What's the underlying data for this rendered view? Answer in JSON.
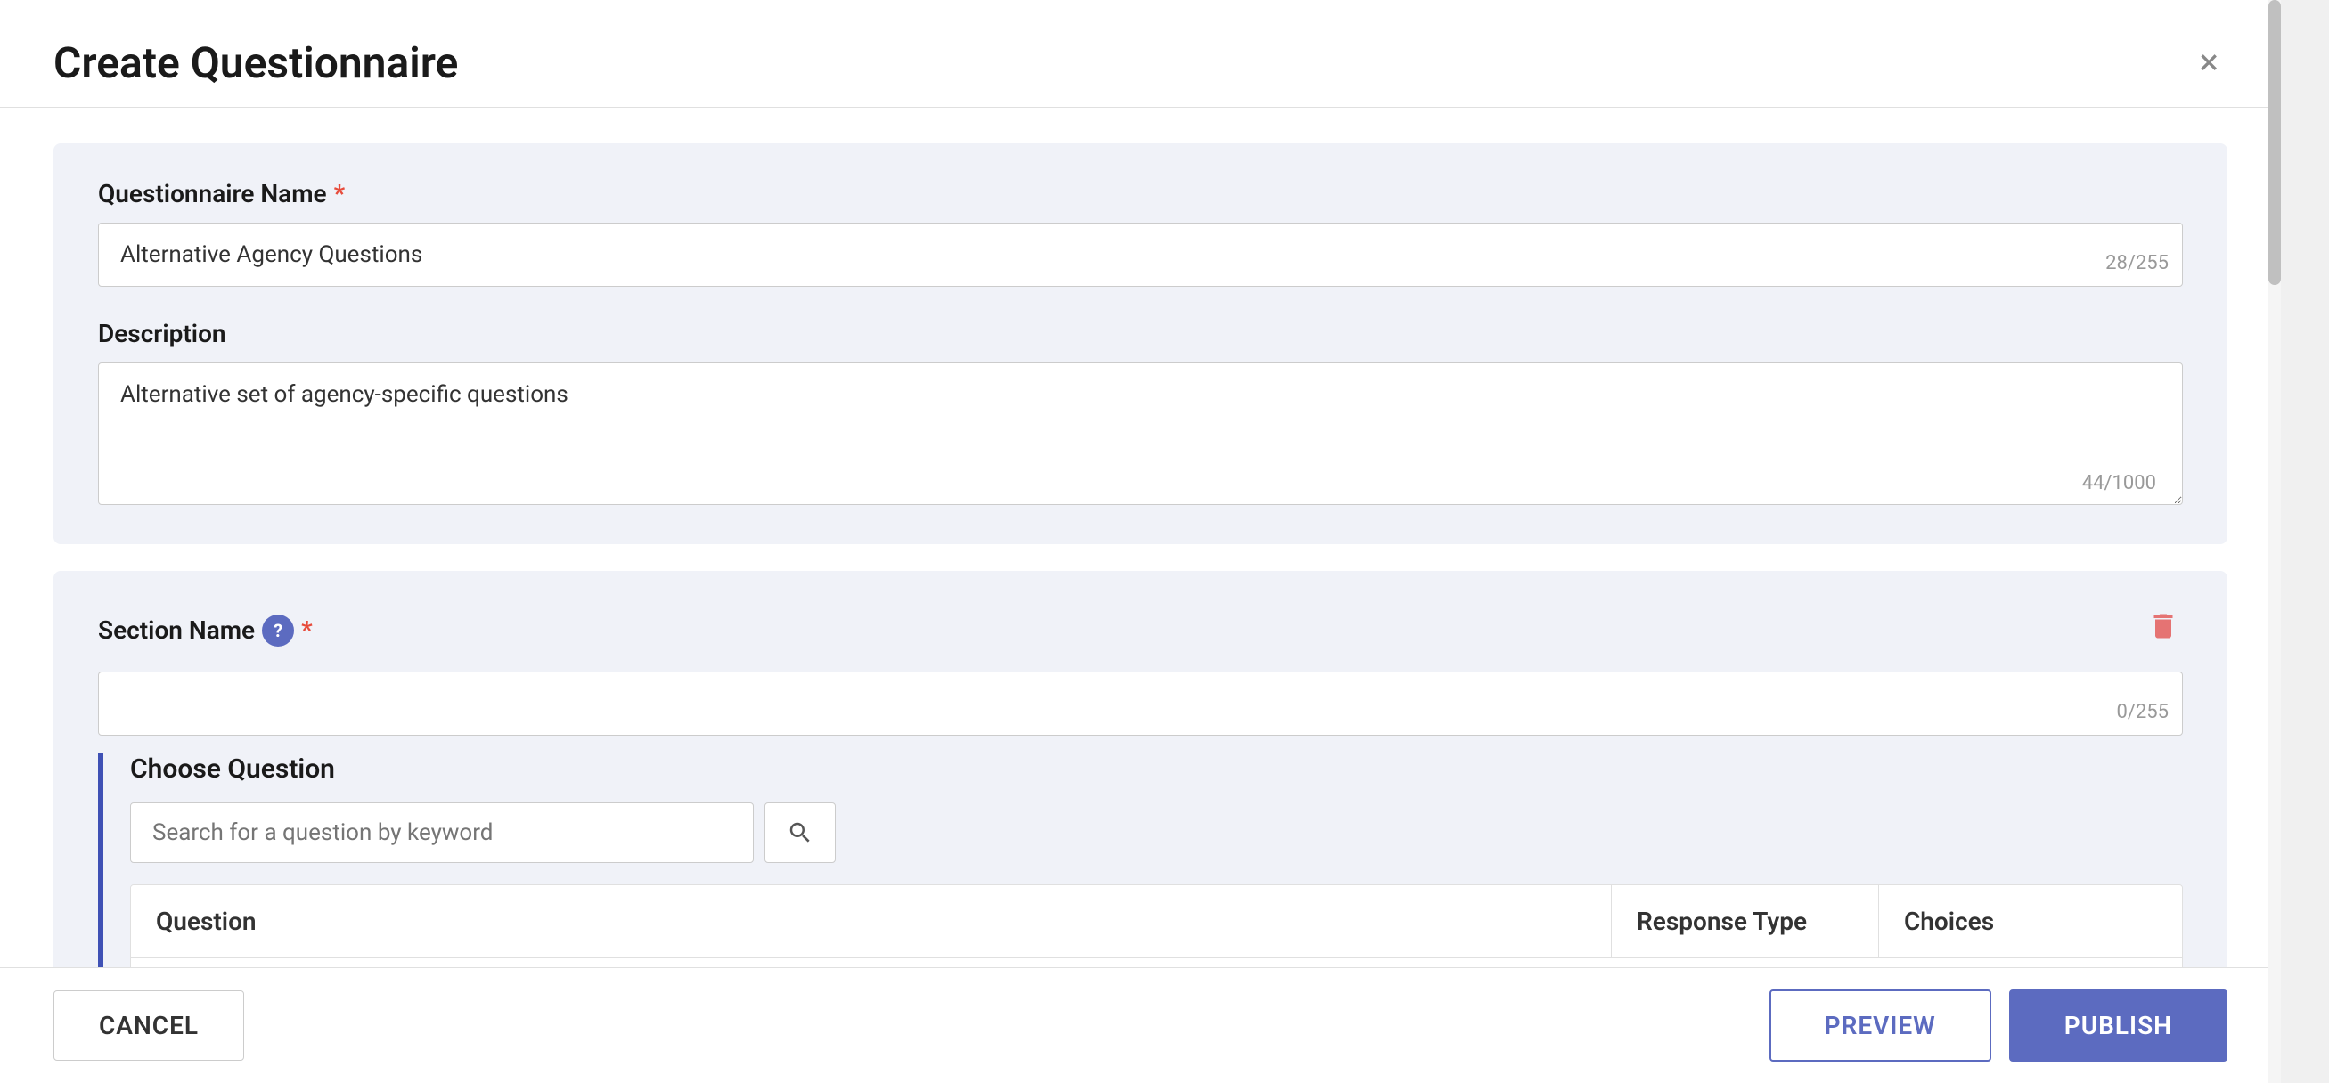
{
  "modal": {
    "title": "Create Questionnaire",
    "close_label": "×"
  },
  "questionnaire_section": {
    "name_label": "Questionnaire Name",
    "required_marker": "*",
    "name_value": "Alternative Agency Questions",
    "name_char_count": "28/255",
    "description_label": "Description",
    "description_value": "Alternative set of agency-specific questions",
    "description_char_count": "44/1000"
  },
  "section_card": {
    "section_name_label": "Section Name",
    "help_text": "?",
    "required_marker": "*",
    "section_name_char_count": "0/255",
    "section_name_placeholder": "",
    "choose_question_title": "Choose Question",
    "search_placeholder": "Search for a question by keyword",
    "search_icon": "search-icon",
    "table_headers": {
      "question": "Question",
      "response_type": "Response Type",
      "choices": "Choices"
    },
    "delete_icon": "delete-icon"
  },
  "footer": {
    "cancel_label": "CANCEL",
    "preview_label": "PREVIEW",
    "publish_label": "PUBLISH"
  }
}
